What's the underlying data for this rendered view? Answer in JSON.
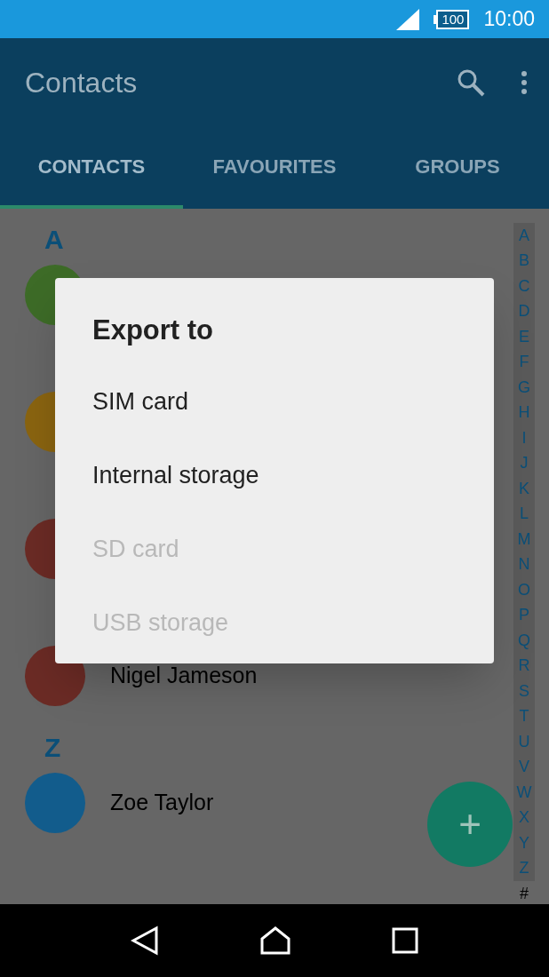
{
  "status_bar": {
    "battery": "100",
    "time": "10:00"
  },
  "app_bar": {
    "title": "Contacts"
  },
  "tabs": [
    {
      "label": "CONTACTS",
      "selected": true
    },
    {
      "label": "FAVOURITES",
      "selected": false
    },
    {
      "label": "GROUPS",
      "selected": false
    }
  ],
  "sections": [
    {
      "letter": "A",
      "contacts": [
        {
          "color": "#3d6b27"
        }
      ]
    },
    {
      "contacts": [
        {
          "color": "#8a6410"
        }
      ]
    },
    {
      "contacts": [
        {
          "color": "#6b2b25"
        }
      ]
    },
    {
      "contacts": [
        {
          "name": "Nigel Jameson",
          "color": "#6b2b25"
        }
      ]
    },
    {
      "letter": "Z",
      "contacts": [
        {
          "name": "Zoe Taylor",
          "color": "#125c8c"
        }
      ]
    }
  ],
  "index": [
    "A",
    "B",
    "C",
    "D",
    "E",
    "F",
    "G",
    "H",
    "I",
    "J",
    "K",
    "L",
    "M",
    "N",
    "O",
    "P",
    "Q",
    "R",
    "S",
    "T",
    "U",
    "V",
    "W",
    "X",
    "Y",
    "Z",
    "#"
  ],
  "fab": {
    "label": "+"
  },
  "dialog": {
    "title": "Export to",
    "options": [
      {
        "label": "SIM card",
        "disabled": false
      },
      {
        "label": "Internal storage",
        "disabled": false
      },
      {
        "label": "SD card",
        "disabled": true
      },
      {
        "label": "USB storage",
        "disabled": true
      }
    ]
  }
}
